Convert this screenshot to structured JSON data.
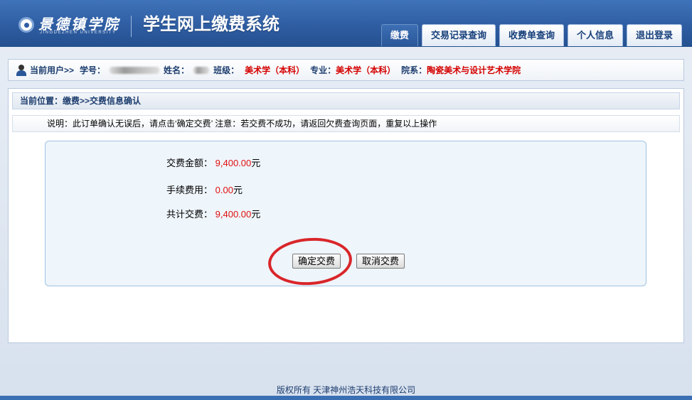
{
  "header": {
    "logo_cn": "景德镇学院",
    "logo_en": "JINGDEZHEN UNIVERSITY",
    "system_title": "学生网上缴费系统"
  },
  "nav": {
    "tabs": [
      {
        "label": "缴费",
        "active": true
      },
      {
        "label": "交易记录查询",
        "active": false
      },
      {
        "label": "收费单查询",
        "active": false
      },
      {
        "label": "个人信息",
        "active": false
      },
      {
        "label": "退出登录",
        "active": false
      }
    ]
  },
  "userbar": {
    "current_user": "当前用户>>",
    "student_id_label": "学号：",
    "name_label": "姓名：",
    "class_label": "班级：",
    "class_value": "美术学（本科）",
    "major_label": "专业：",
    "major_value": "美术学（本科）",
    "dept_label": "院系：",
    "dept_value": "陶瓷美术与设计艺术学院"
  },
  "location": "当前位置：缴费>>交费信息确认",
  "note": "说明：此订单确认无误后，请点击‘确定交费’ 注意：若交费不成功，请返回欠费查询页面，重复以上操作",
  "payment": {
    "amount_label": "交费金额：",
    "amount_value": "9,400.00",
    "fee_label": "手续费用：",
    "fee_value": "0.00",
    "total_label": "共计交费：",
    "total_value": "9,400.00",
    "unit": "元"
  },
  "buttons": {
    "confirm": "确定交费",
    "cancel": "取消交费"
  },
  "footer": "版权所有 天津神州浩天科技有限公司",
  "colors": {
    "header_blue": "#2f5da2",
    "value_red": "#e01010",
    "highlight_ring": "#d9262a"
  }
}
